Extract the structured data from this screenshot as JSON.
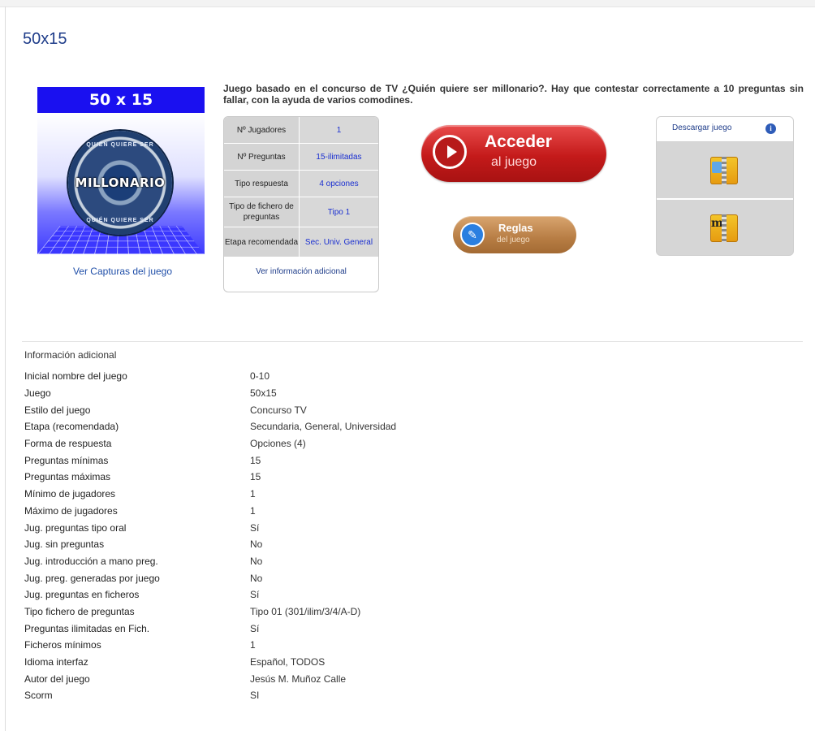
{
  "page": {
    "title": "50x15"
  },
  "game_logo": {
    "band_text": "50 x 15",
    "disc_text": "MILLONARIO",
    "disc_top": "QUIÉN QUIERE SER",
    "disc_bottom": "QUIÉN QUIERE SER"
  },
  "captures_link": "Ver Capturas del juego",
  "description": "Juego basado en el concurso de TV ¿Quién quiere ser millonario?. Hay que contestar correctamente a 10 preguntas sin fallar, con la ayuda de varios comodines.",
  "summary": {
    "rows": [
      {
        "label": "Nº Jugadores",
        "value": "1"
      },
      {
        "label": "Nº Preguntas",
        "value": "15-ilimitadas"
      },
      {
        "label": "Tipo respuesta",
        "value": "4 opciones"
      },
      {
        "label": "Tipo de fichero de preguntas",
        "value": "Tipo 1"
      },
      {
        "label": "Etapa recomendada",
        "value": "Sec. Univ. General"
      }
    ],
    "more_link": "Ver información adicional"
  },
  "access_button": {
    "line1": "Acceder",
    "line2": "al juego"
  },
  "rules_button": {
    "line1": "Reglas",
    "line2": "del juego"
  },
  "download": {
    "title": "Descargar juego",
    "info_glyph": "i",
    "items": [
      {
        "icon": "zip-file-icon"
      },
      {
        "icon": "mini-zip-file-icon",
        "tag": "m"
      }
    ]
  },
  "info": {
    "title": "Información adicional",
    "rows": [
      {
        "k": "Inicial nombre del juego",
        "v": "0-10"
      },
      {
        "k": "Juego",
        "v": "50x15"
      },
      {
        "k": "Estilo del juego",
        "v": "Concurso TV"
      },
      {
        "k": "Etapa (recomendada)",
        "v": "Secundaria, General, Universidad"
      },
      {
        "k": "Forma de respuesta",
        "v": "Opciones (4)"
      },
      {
        "k": "Preguntas mínimas",
        "v": "15"
      },
      {
        "k": "Preguntas máximas",
        "v": "15"
      },
      {
        "k": "Mínimo de jugadores",
        "v": "1"
      },
      {
        "k": "Máximo de jugadores",
        "v": "1"
      },
      {
        "k": "Jug. preguntas tipo oral",
        "v": "Sí"
      },
      {
        "k": "Jug. sin preguntas",
        "v": "No"
      },
      {
        "k": "Jug. introducción a mano preg.",
        "v": "No"
      },
      {
        "k": "Jug. preg. generadas por juego",
        "v": "No"
      },
      {
        "k": "Jug. preguntas en ficheros",
        "v": "Sí"
      },
      {
        "k": "Tipo fichero de preguntas",
        "v": "Tipo 01 (301/ilim/3/4/A-D)"
      },
      {
        "k": "Preguntas ilimitadas en Fich.",
        "v": "Sí"
      },
      {
        "k": "Ficheros mínimos",
        "v": "1"
      },
      {
        "k": "Idioma interfaz",
        "v": "Español, TODOS"
      },
      {
        "k": "Autor del juego",
        "v": "Jesús M. Muñoz Calle"
      },
      {
        "k": "Scorm",
        "v": "SI"
      }
    ]
  }
}
